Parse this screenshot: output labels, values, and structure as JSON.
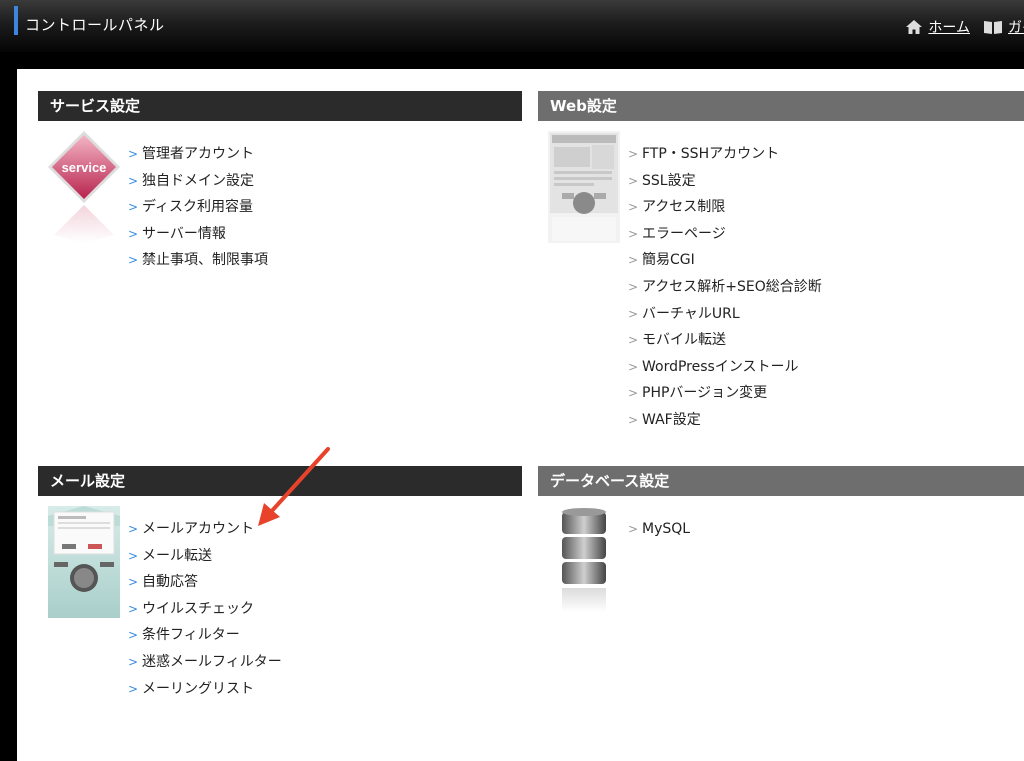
{
  "header": {
    "title": "コントロールパネル",
    "nav": [
      {
        "label": "ホーム",
        "icon": "home-icon"
      },
      {
        "label": "ガイ",
        "icon": "book-icon"
      }
    ]
  },
  "sections": {
    "service": {
      "title": "サービス設定",
      "image_label": "service",
      "items": [
        "管理者アカウント",
        "独自ドメイン設定",
        "ディスク利用容量",
        "サーバー情報",
        "禁止事項、制限事項"
      ]
    },
    "web": {
      "title": "Web設定",
      "items": [
        "FTP・SSHアカウント",
        "SSL設定",
        "アクセス制限",
        "エラーページ",
        "簡易CGI",
        "アクセス解析+SEO総合診断",
        "バーチャルURL",
        "モバイル転送",
        "WordPressインストール",
        "PHPバージョン変更",
        "WAF設定"
      ]
    },
    "mail": {
      "title": "メール設定",
      "items": [
        "メールアカウント",
        "メール転送",
        "自動応答",
        "ウイルスチェック",
        "条件フィルター",
        "迷惑メールフィルター",
        "メーリングリスト"
      ]
    },
    "database": {
      "title": "データベース設定",
      "items": [
        "MySQL"
      ]
    }
  },
  "colors": {
    "accent": "#3a86e0",
    "arrow": "#e8432a",
    "chevron_blue": "#3a8be0",
    "chevron_gray": "#9a9a9a"
  }
}
